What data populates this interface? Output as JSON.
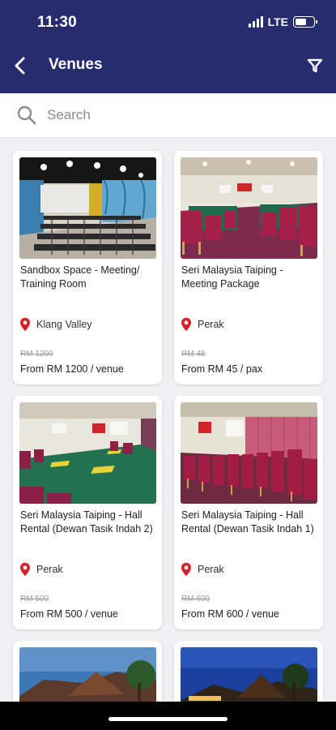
{
  "status_bar": {
    "time": "11:30",
    "network": "LTE",
    "battery_level": 0.6
  },
  "header": {
    "title": "Venues",
    "back_icon": "chevron-left-icon",
    "filter_icon": "filter-icon"
  },
  "search": {
    "placeholder": "Search",
    "value": ""
  },
  "venues": [
    {
      "name": "Sandbox Space - Meeting/ Training Room",
      "location": "Klang Valley",
      "old_price": "RM 1200",
      "price": "From RM 1200 / venue"
    },
    {
      "name": "Seri Malaysia Taiping - Meeting Package",
      "location": "Perak",
      "old_price": "RM 45",
      "price": "From RM 45 / pax"
    },
    {
      "name": "Seri Malaysia Taiping - Hall Rental (Dewan Tasik Indah 2)",
      "location": "Perak",
      "old_price": "RM 500",
      "price": "From RM 500 / venue"
    },
    {
      "name": "Seri Malaysia Taiping - Hall Rental (Dewan Tasik Indah 1)",
      "location": "Perak",
      "old_price": "RM 600",
      "price": "From RM 600 / venue"
    }
  ],
  "colors": {
    "header_bg": "#262c6e",
    "location_pin": "#d2232a",
    "page_bg": "#f0f0f2"
  }
}
